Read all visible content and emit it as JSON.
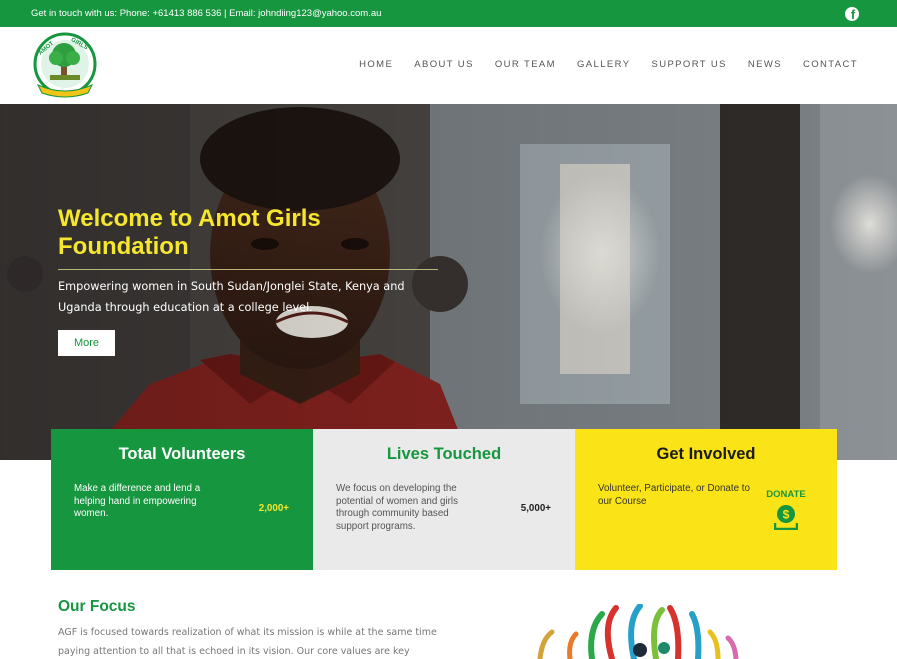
{
  "topbar": {
    "contact_text": "Get in touch with us: Phone: +61413 886 536 | Email: johndiing123@yahoo.com.au",
    "facebook_icon": "facebook-icon"
  },
  "header": {
    "logo_icon": "amot-girls-foundation-logo",
    "nav": [
      "HOME",
      "ABOUT US",
      "OUR TEAM",
      "GALLERY",
      "SUPPORT US",
      "NEWS",
      "CONTACT"
    ]
  },
  "hero": {
    "title": "Welcome to Amot Girls Foundation",
    "subtitle": "Empowering women in South Sudan/Jonglei State, Kenya and Uganda through education at a college level.",
    "button_label": "More"
  },
  "cards": [
    {
      "title": "Total Volunteers",
      "text": "Make a difference and lend a helping hand in empowering women.",
      "stat": "2,000+",
      "color": "#16963f"
    },
    {
      "title": "Lives Touched",
      "text": "We focus on developing the potential of women and girls through community based support programs.",
      "stat": "5,000+",
      "color": "#eaeaea"
    },
    {
      "title": "Get Involved",
      "text": "Volunteer, Participate, or Donate to our Course",
      "donate_label": "DONATE",
      "donate_icon": "donate-money-icon",
      "color": "#fae316"
    }
  ],
  "focus": {
    "title": "Our Focus",
    "text": "AGF is focused towards realization of what its mission is while at the same time paying attention to all that is echoed in its vision. Our core values are key"
  },
  "colors": {
    "brand_green": "#16963f",
    "brand_yellow": "#fae316",
    "hero_title": "#f5e62e"
  }
}
